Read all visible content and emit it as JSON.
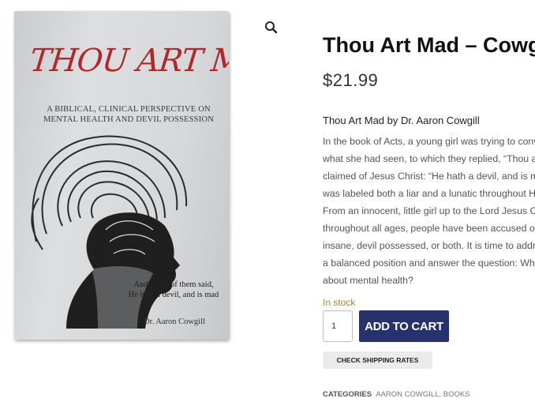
{
  "gallery": {
    "zoom_icon": "search-icon",
    "book": {
      "title": "THOU ART MAD",
      "subtitle": "A BIBLICAL, CLINICAL PERSPECTIVE ON MENTAL HEALTH AND DEVIL POSSESSION",
      "quote_line1": "And many of them said,",
      "quote_line2": "He hath a devil, and is mad",
      "author": "Dr. Aaron Cowgill",
      "title_color": "#b2282a"
    }
  },
  "product": {
    "title": "Thou Art Mad – Cowgill",
    "price": "$21.99",
    "description_heading": "Thou Art Mad by Dr. Aaron Cowgill",
    "description_lines": [
      "In the book of Acts, a young girl was trying to convince others of",
      "what she had seen, to which they replied, “Thou art mad.” It is",
      "claimed of Jesus Christ: “He hath a devil, and is mad.” The Lord",
      "was labeled both a liar and a lunatic throughout His ministry.",
      "From an innocent, little girl up to the Lord Jesus Christ Himself,",
      "throughout all ages, people have been accused of being",
      "insane, devil possessed, or both. It is time to address this from",
      "a balanced position and answer the question: What does God say",
      "about mental health?"
    ],
    "stock": "In stock",
    "quantity": "1",
    "add_to_cart_label": "ADD TO CART",
    "shipping_label": "CHECK SHIPPING RATES",
    "categories_label": "CATEGORIES",
    "categories": [
      "AARON COWGILL",
      "BOOKS"
    ],
    "accent_color": "#25326d",
    "stock_color": "#a08a2b"
  }
}
